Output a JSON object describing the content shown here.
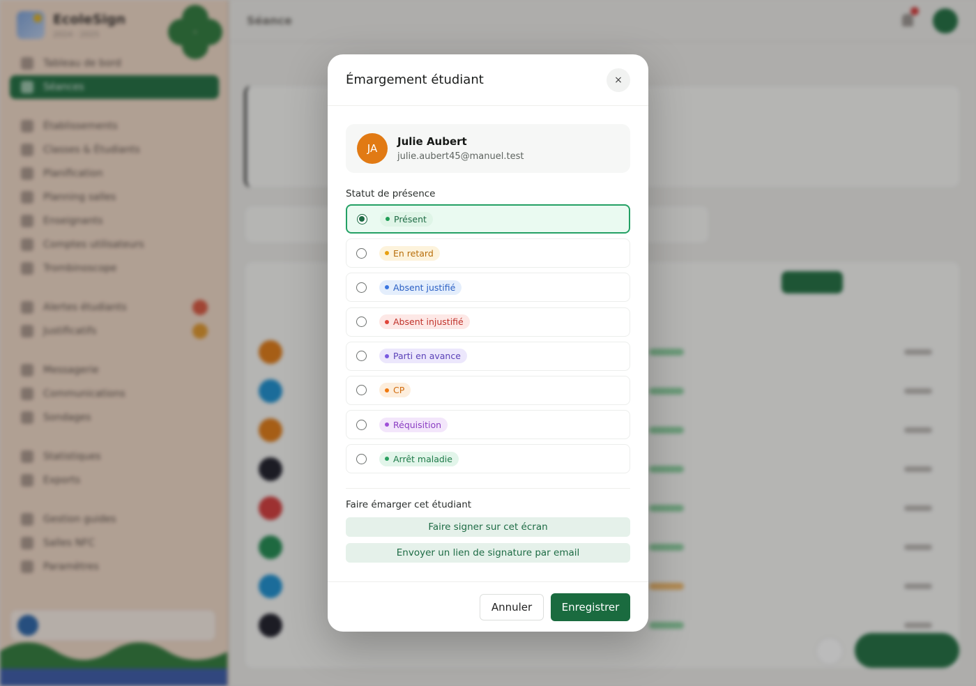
{
  "background": {
    "brand": {
      "name": "EcoleSign",
      "subtitle": "2024 · 2025"
    },
    "page_title": "Séance",
    "sidebar_items": [
      "Tableau de bord",
      "Séances",
      "Établissements",
      "Classes & Étudiants",
      "Planification",
      "Planning salles",
      "Enseignants",
      "Comptes utilisateurs",
      "Trombinoscope",
      "Alertes étudiants",
      "Justificatifs",
      "Messagerie",
      "Communications",
      "Sondages",
      "Statistiques",
      "Exports",
      "Gestion guides",
      "Salles NFC",
      "Paramètres"
    ]
  },
  "modal": {
    "title": "Émargement étudiant",
    "close_label": "×",
    "student": {
      "initials": "JA",
      "name": "Julie Aubert",
      "email": "julie.aubert45@manuel.test"
    },
    "status_label": "Statut de présence",
    "options": [
      {
        "label": "Présent",
        "dot": "#1f9d55",
        "text": "#1d6b44",
        "bg": "#dff5e7",
        "selected": true
      },
      {
        "label": "En retard",
        "dot": "#e8a010",
        "text": "#b86e0a",
        "bg": "#fdf3dc",
        "selected": false
      },
      {
        "label": "Absent justifié",
        "dot": "#3b76e0",
        "text": "#2a5fc4",
        "bg": "#e4eefc",
        "selected": false
      },
      {
        "label": "Absent injustifié",
        "dot": "#e0443a",
        "text": "#c0322a",
        "bg": "#fde8e6",
        "selected": false
      },
      {
        "label": "Parti en avance",
        "dot": "#7a5ae0",
        "text": "#5b42b8",
        "bg": "#ece7fc",
        "selected": false
      },
      {
        "label": "CP",
        "dot": "#f07a10",
        "text": "#d06a0c",
        "bg": "#fdeedd",
        "selected": false
      },
      {
        "label": "Réquisition",
        "dot": "#a050d8",
        "text": "#8a3cc2",
        "bg": "#f3e6fb",
        "selected": false
      },
      {
        "label": "Arrêt maladie",
        "dot": "#2aa060",
        "text": "#1d7a48",
        "bg": "#e2f5ea",
        "selected": false
      }
    ],
    "sign_section_label": "Faire émarger cet étudiant",
    "sign_here_label": "Faire signer sur cet écran",
    "sign_email_label": "Envoyer un lien de signature par email",
    "cancel_label": "Annuler",
    "save_label": "Enregistrer"
  }
}
